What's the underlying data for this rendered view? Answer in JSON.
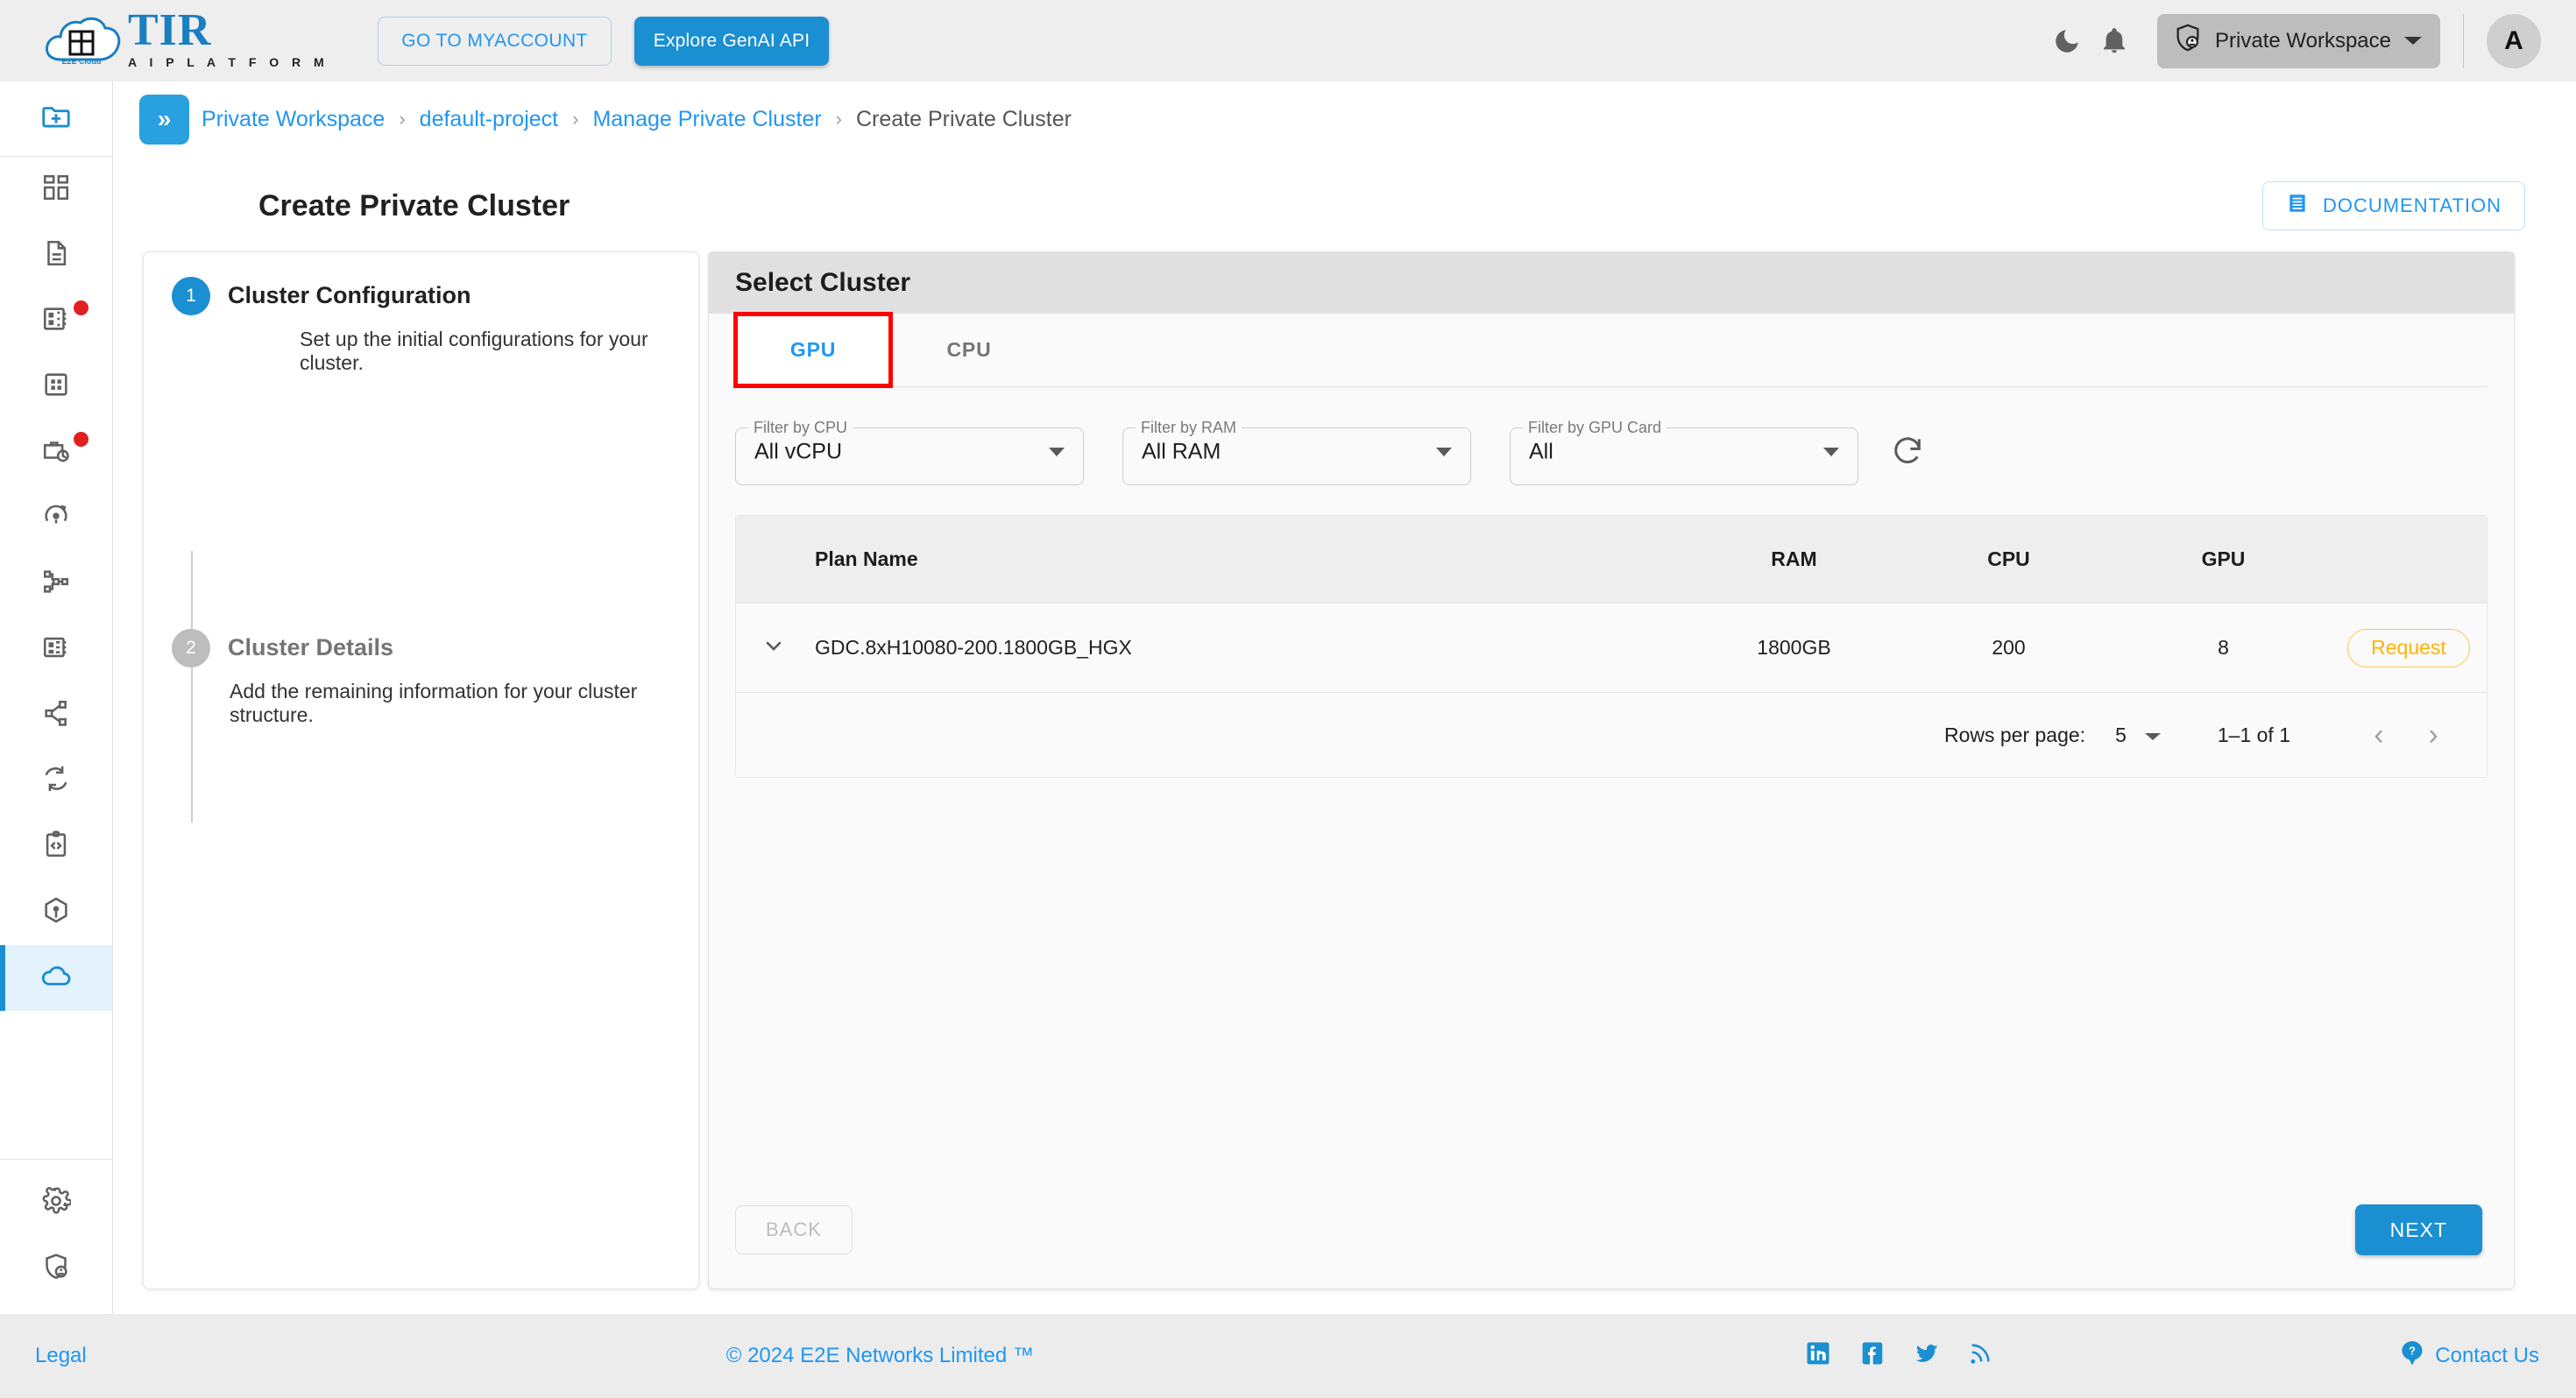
{
  "topbar": {
    "logo_title": "TIR",
    "logo_subtitle": "A I   P L A T F O R M",
    "logo_badge": "E2E Cloud",
    "myaccount_label": "GO TO MYACCOUNT",
    "genai_label": "Explore GenAI API",
    "workspace_label": "Private Workspace",
    "avatar_letter": "A",
    "icons": [
      "dark-mode-icon",
      "notification-bell-icon",
      "workspace-shield-icon",
      "chevron-down-icon"
    ],
    "accent_blue": "#1a8fd1"
  },
  "breadcrumb": {
    "toggle_glyph": "»",
    "items": [
      {
        "label": "Private Workspace",
        "link": true
      },
      {
        "label": "default-project",
        "link": true
      },
      {
        "label": "Manage Private Cluster",
        "link": true
      },
      {
        "label": "Create Private Cluster",
        "link": false
      }
    ],
    "separator": "›"
  },
  "page": {
    "title": "Create Private Cluster",
    "documentation_label": "DOCUMENTATION"
  },
  "sidebar": {
    "top_item": "new-project-folder-icon",
    "items": [
      "dashboard-grid-icon",
      "document-icon",
      "notebook-icon",
      "containers-grid-icon",
      "jobs-briefcase-clock-icon",
      "model-endpoint-icon",
      "pipeline-nodes-icon",
      "gpu-chip-icon",
      "share-network-icon",
      "sync-refresh-icon",
      "code-clipboard-icon",
      "package-cube-icon",
      "cloud-icon"
    ],
    "bottom_items": [
      "settings-gear-icon",
      "security-shield-icon"
    ],
    "active_index": 12,
    "badges": [
      2,
      4
    ]
  },
  "stepper": {
    "steps": [
      {
        "number": "1",
        "title": "Cluster Configuration",
        "description": "Set up the initial configurations for your cluster.",
        "active": true
      },
      {
        "number": "2",
        "title": "Cluster Details",
        "description": "Add the remaining information for your cluster structure.",
        "active": false
      }
    ]
  },
  "main": {
    "card_title": "Select Cluster",
    "tabs": [
      {
        "label": "GPU",
        "active": true,
        "highlighted": true
      },
      {
        "label": "CPU",
        "active": false,
        "highlighted": false
      }
    ],
    "filters": [
      {
        "legend": "Filter by CPU",
        "value": "All vCPU"
      },
      {
        "legend": "Filter by RAM",
        "value": "All RAM"
      },
      {
        "legend": "Filter by GPU Card",
        "value": "All"
      }
    ],
    "refresh_icon": "refresh-icon",
    "table": {
      "columns": [
        "Plan Name",
        "RAM",
        "CPU",
        "GPU"
      ],
      "rows": [
        {
          "expand_icon": "chevron-down-icon",
          "plan_name": "GDC.8xH10080-200.1800GB_HGX",
          "ram": "1800GB",
          "cpu": "200",
          "gpu": "8",
          "action_label": "Request"
        }
      ]
    },
    "pagination": {
      "rows_per_page_label": "Rows per page:",
      "rows_per_page_value": "5",
      "range_label": "1–1 of 1",
      "prev_glyph": "‹",
      "next_glyph": "›"
    },
    "back_label": "BACK",
    "next_label": "NEXT"
  },
  "footer": {
    "legal": "Legal",
    "copyright": "© 2024 E2E Networks Limited ™",
    "social": [
      "linkedin-icon",
      "facebook-icon",
      "twitter-icon",
      "rss-icon"
    ],
    "contact_label": "Contact Us"
  }
}
